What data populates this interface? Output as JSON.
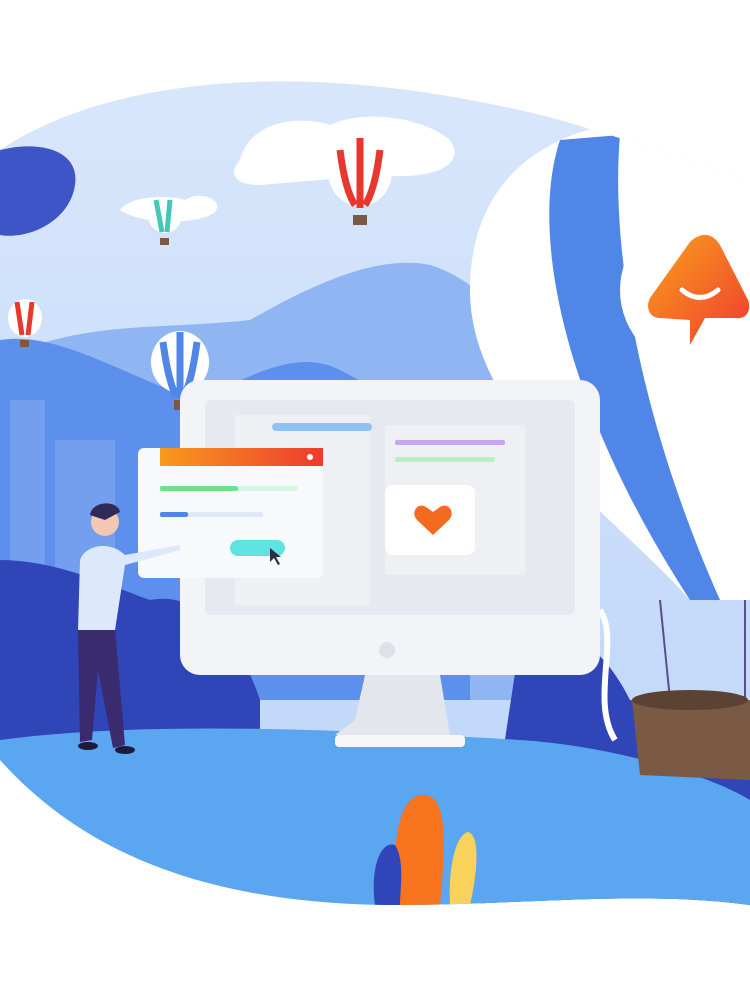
{
  "illustration": {
    "subject": "hot-air-balloon-app-promo",
    "colors": {
      "sky": "#cfe2fb",
      "mountain_light": "#8fb6f2",
      "mountain_dark": "#4f86e8",
      "foliage_dark": "#2f45b8",
      "foliage_mid": "#3f6fe0",
      "water": "#5aa6f0",
      "accent_orange": "#f7731e",
      "accent_red": "#e8372c",
      "accent_teal": "#5fe3e0",
      "accent_green": "#6fe08a",
      "monitor": "#f2f4f8",
      "heart": "#f46a1f",
      "basket": "#7a5a44"
    },
    "icons": [
      "logo-icon",
      "heart-icon",
      "cursor-icon"
    ]
  }
}
